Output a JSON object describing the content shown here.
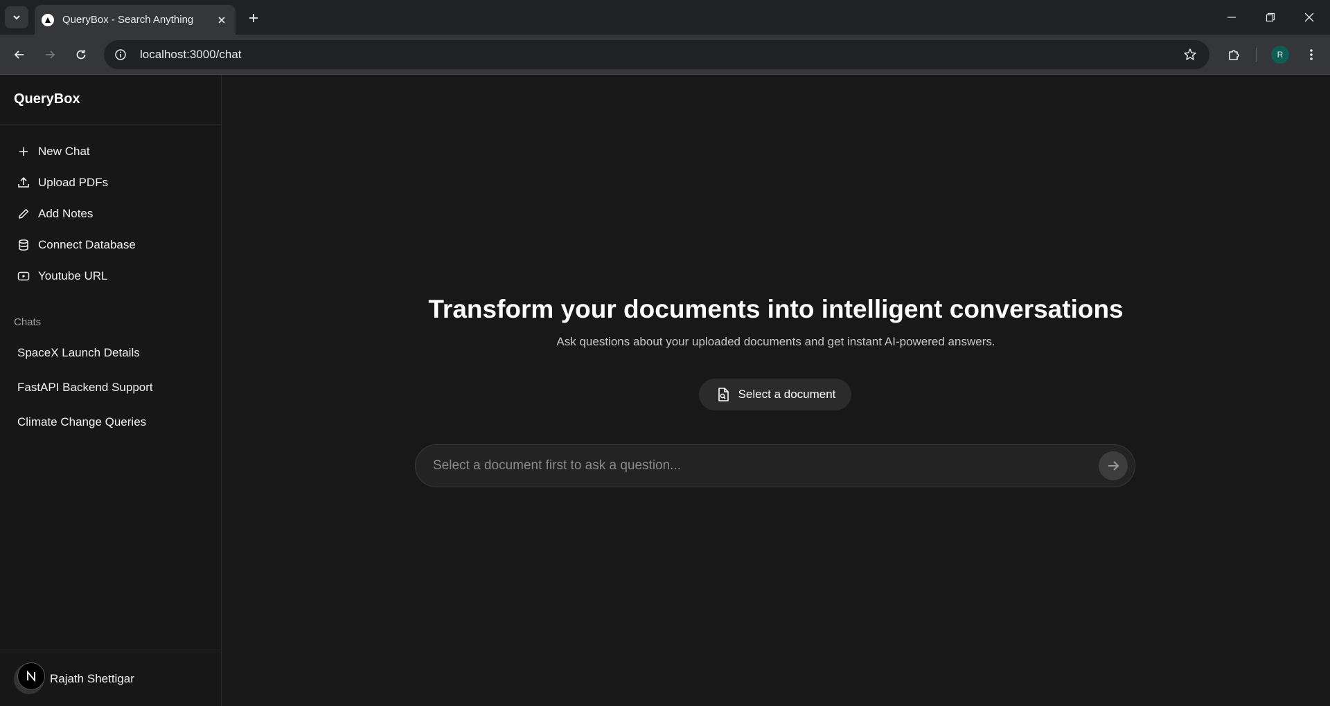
{
  "browser": {
    "tab_title": "QueryBox - Search Anything",
    "url": "localhost:3000/chat",
    "profile_initial": "R"
  },
  "app": {
    "brand": "QueryBox",
    "menu": [
      {
        "label": "New Chat",
        "icon": "plus-icon"
      },
      {
        "label": "Upload PDFs",
        "icon": "upload-icon"
      },
      {
        "label": "Add Notes",
        "icon": "pencil-icon"
      },
      {
        "label": "Connect Database",
        "icon": "database-icon"
      },
      {
        "label": "Youtube URL",
        "icon": "youtube-icon"
      }
    ],
    "chats_label": "Chats",
    "chats": [
      "SpaceX Launch Details",
      "FastAPI Backend Support",
      "Climate Change Queries"
    ],
    "user": {
      "name": "Rajath Shettigar",
      "avatar_letter": "N"
    }
  },
  "main": {
    "headline": "Transform your documents into intelligent conversations",
    "subheadline": "Ask questions about your uploaded documents and get instant AI-powered answers.",
    "select_button": "Select a document",
    "input_placeholder": "Select a document first to ask a question..."
  }
}
